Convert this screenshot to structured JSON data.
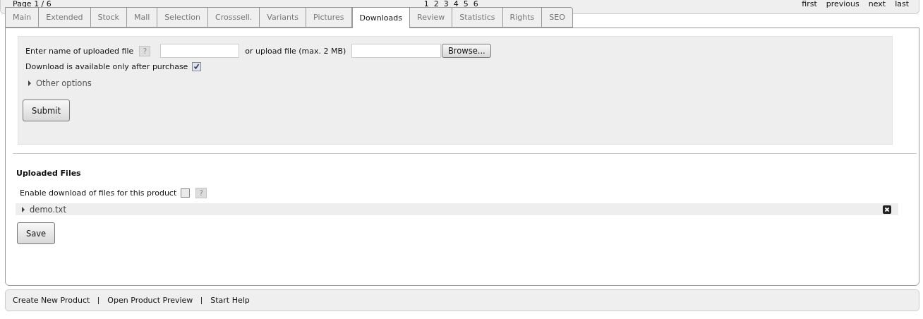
{
  "pager": {
    "label": "Page 1 / 6",
    "pages": [
      "1",
      "2",
      "3",
      "4",
      "5",
      "6"
    ],
    "nav": [
      "first",
      "previous",
      "next",
      "last"
    ]
  },
  "tabs": [
    {
      "label": "Main",
      "selected": false
    },
    {
      "label": "Extended",
      "selected": false
    },
    {
      "label": "Stock",
      "selected": false
    },
    {
      "label": "Mall",
      "selected": false
    },
    {
      "label": "Selection",
      "selected": false
    },
    {
      "label": "Crosssell.",
      "selected": false
    },
    {
      "label": "Variants",
      "selected": false
    },
    {
      "label": "Pictures",
      "selected": false
    },
    {
      "label": "Downloads",
      "selected": true
    },
    {
      "label": "Review",
      "selected": false
    },
    {
      "label": "Statistics",
      "selected": false
    },
    {
      "label": "Rights",
      "selected": false
    },
    {
      "label": "SEO",
      "selected": false
    }
  ],
  "upload_form": {
    "name_label": "Enter name of uploaded file",
    "help": "?",
    "upload_label": "or upload file (max. 2 MB)",
    "browse_button": "Browse...",
    "purchase_label": "Download is available only after purchase",
    "purchase_checked": true,
    "other_options": "Other options",
    "other_options_expanded": false,
    "submit_button": "Submit"
  },
  "uploaded_files": {
    "title": "Uploaded Files",
    "enable_label": "Enable download of files for this product",
    "enable_checked": false,
    "help": "?",
    "files": [
      {
        "name": "demo.txt",
        "expanded": false
      }
    ],
    "save_button": "Save"
  },
  "footer_links": [
    "Create New Product",
    "Open Product Preview",
    "Start Help"
  ]
}
